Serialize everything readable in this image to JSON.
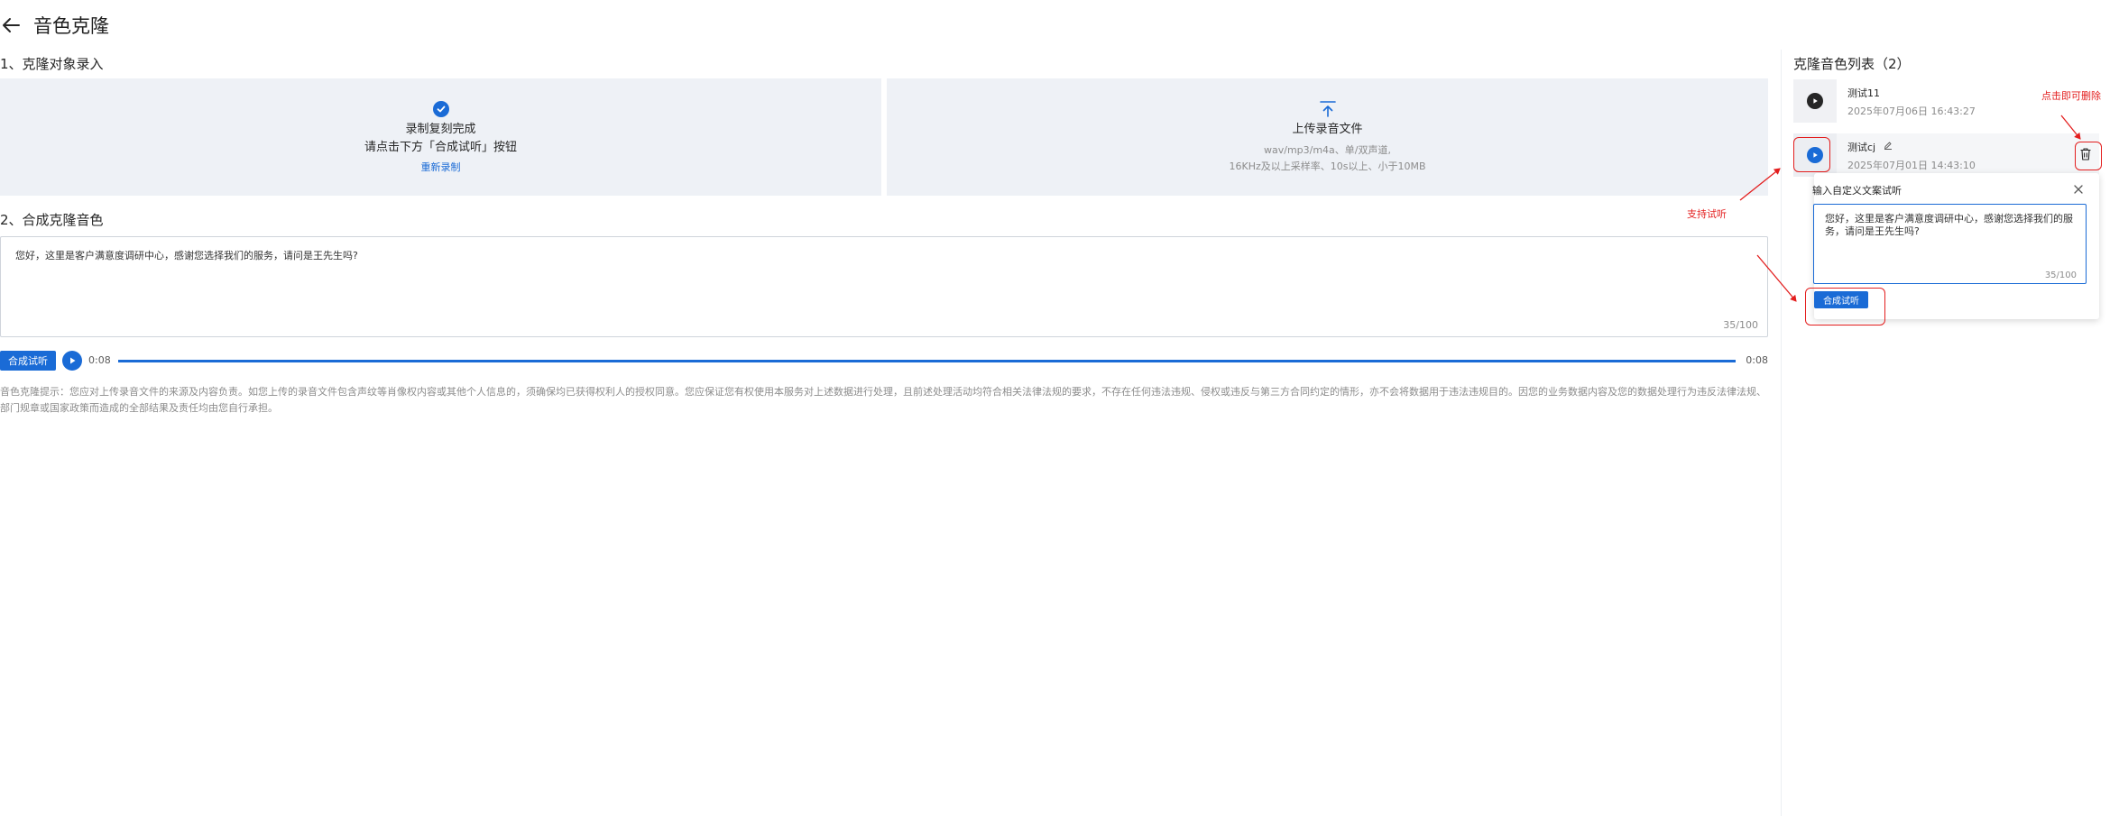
{
  "header": {
    "title": "音色克隆"
  },
  "section1": {
    "title": "1、克隆对象录入",
    "record_card": {
      "status": "录制复刻完成",
      "hint": "请点击下方「合成试听」按钮",
      "rerecord_link": "重新录制"
    },
    "upload_card": {
      "title": "上传录音文件",
      "formats": "wav/mp3/m4a、单/双声道,",
      "requirements": "16KHz及以上采样率、10s以上、小于10MB"
    }
  },
  "section2": {
    "title": "2、合成克隆音色",
    "text": "您好，这里是客户满意度调研中心，感谢您选择我们的服务，请问是王先生吗?",
    "char_count": "35/100",
    "synth_button": "合成试听",
    "player": {
      "current_time": "0:08",
      "duration": "0:08",
      "progress": 1.0
    }
  },
  "disclaimer": "音色克隆提示：您应对上传录音文件的来源及内容负责。如您上传的录音文件包含声纹等肖像权内容或其他个人信息的，须确保均已获得权利人的授权同意。您应保证您有权使用本服务对上述数据进行处理，且前述处理活动均符合相关法律法规的要求，不存在任何违法违规、侵权或违反与第三方合同约定的情形，亦不会将数据用于违法违规目的。因您的业务数据内容及您的数据处理行为违反法律法规、部门规章或国家政策而造成的全部结果及责任均由您自行承担。",
  "voice_list": {
    "title": "克隆音色列表（2）",
    "items": [
      {
        "name": "测试11",
        "date": "2025年07月06日 16:43:27"
      },
      {
        "name": "测试cj",
        "date": "2025年07月01日 14:43:10"
      }
    ]
  },
  "popover": {
    "title": "输入自定义文案试听",
    "text": "您好，这里是客户满意度调研中心，感谢您选择我们的服务，请问是王先生吗?",
    "char_count": "35/100",
    "button": "合成试听"
  },
  "annotations": {
    "support_listen": "支持试听",
    "click_delete": "点击即可删除"
  },
  "colors": {
    "accent": "#1a6bd6",
    "annotation": "#e31e1e",
    "card_bg": "#eef1f6"
  }
}
